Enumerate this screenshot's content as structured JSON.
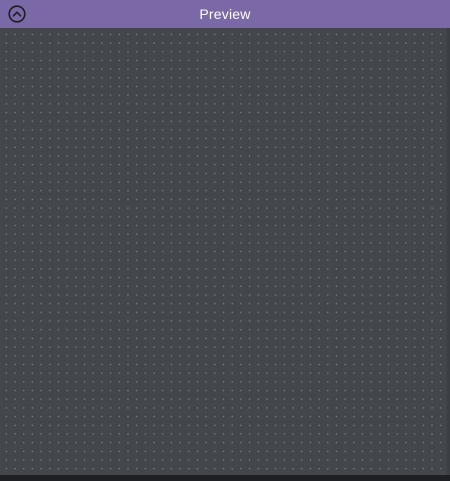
{
  "header": {
    "title": "Preview",
    "collapse_icon": "chevron-up-circle-icon"
  },
  "colors": {
    "header_bg": "#7a68a7",
    "canvas_bg": "#43464b",
    "grid_dot": "#bec3cd"
  }
}
